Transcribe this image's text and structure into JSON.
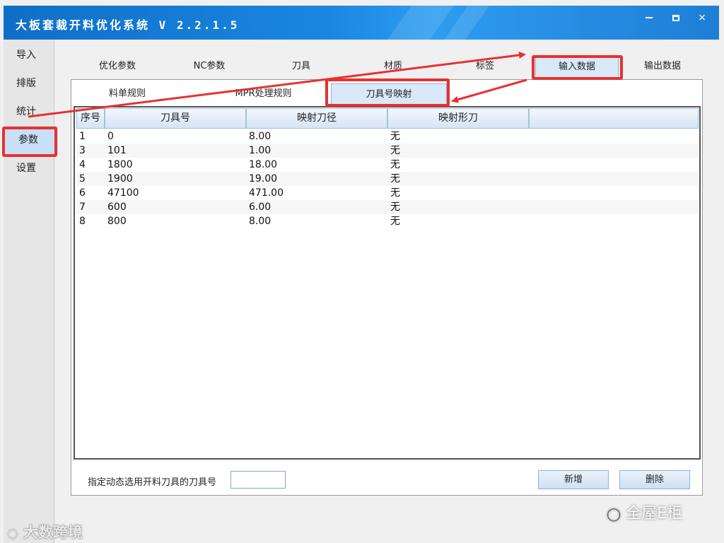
{
  "app": {
    "title": "大板套裁开料优化系统 V 2.2.1.5"
  },
  "window_controls": {
    "minimize": "minimize-icon",
    "maximize": "maximize-icon",
    "close": "×"
  },
  "sidebar": {
    "items": [
      {
        "label": "导入"
      },
      {
        "label": "排版"
      },
      {
        "label": "统计"
      },
      {
        "label": "参数"
      },
      {
        "label": "设置"
      }
    ],
    "active": "参数"
  },
  "top_tabs": [
    {
      "label": "优化参数"
    },
    {
      "label": "NC参数"
    },
    {
      "label": "刀具"
    },
    {
      "label": "材质"
    },
    {
      "label": "标签"
    },
    {
      "label": "输入数据"
    },
    {
      "label": "输出数据"
    }
  ],
  "sub_tabs": [
    {
      "label": "料单规则"
    },
    {
      "label": "MPR处理规则"
    },
    {
      "label": "刀具号映射"
    }
  ],
  "table": {
    "headers": [
      "序号",
      "刀具号",
      "映射刀径",
      "映射形刀"
    ],
    "rows": [
      [
        "1",
        "0",
        "8.00",
        "无"
      ],
      [
        "3",
        "101",
        "1.00",
        "无"
      ],
      [
        "4",
        "1800",
        "18.00",
        "无"
      ],
      [
        "5",
        "1900",
        "19.00",
        "无"
      ],
      [
        "6",
        "47100",
        "471.00",
        "无"
      ],
      [
        "7",
        "600",
        "6.00",
        "无"
      ],
      [
        "8",
        "800",
        "8.00",
        "无"
      ]
    ]
  },
  "bottom": {
    "label": "指定动态选用开料刀具的刀具号",
    "input_value": "",
    "add_button": "新增",
    "delete_button": "删除"
  },
  "watermarks": {
    "left": "大数跨境",
    "right": "全屋E柜"
  },
  "colors": {
    "annotation": "#e83030",
    "titlebar": "#1a86e0"
  }
}
